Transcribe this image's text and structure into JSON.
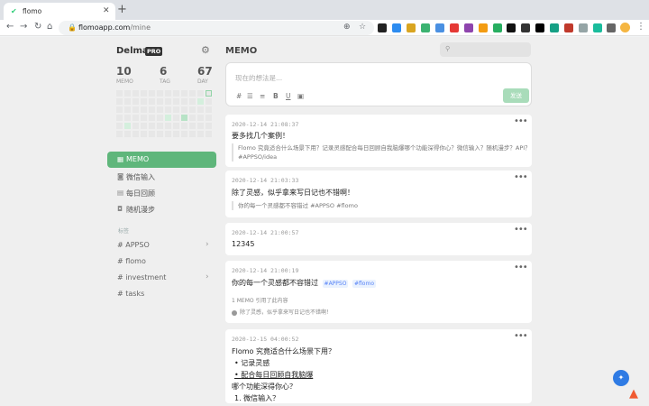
{
  "browser": {
    "tab_title": "flomo",
    "url_host": "flomoapp.com",
    "url_path": "/mine"
  },
  "sidebar": {
    "username": "Delmar",
    "badge": "PRO",
    "stats": [
      {
        "value": "10",
        "label": "MEMO"
      },
      {
        "value": "6",
        "label": "TAG"
      },
      {
        "value": "67",
        "label": "DAY"
      }
    ],
    "nav": [
      {
        "label": "MEMO",
        "icon": "grid-icon",
        "active": true
      },
      {
        "label": "微信输入",
        "icon": "wechat-icon",
        "active": false
      },
      {
        "label": "每日回顾",
        "icon": "calendar-icon",
        "active": false
      },
      {
        "label": "随机漫步",
        "icon": "chat-icon",
        "active": false
      }
    ],
    "tags_heading": "标签",
    "tags": [
      {
        "label": "# APPSO",
        "expandable": true
      },
      {
        "label": "# flomo",
        "expandable": false
      },
      {
        "label": "# investment",
        "expandable": true
      },
      {
        "label": "# tasks",
        "expandable": false
      }
    ]
  },
  "main": {
    "title": "MEMO",
    "editor": {
      "placeholder": "现在的想法是...",
      "tools": [
        "#",
        "☰",
        "≡",
        "B",
        "U",
        "▣"
      ],
      "send_label": "发送"
    },
    "memos": [
      {
        "time": "2020-12-14 21:08:37",
        "text": "要多找几个案例！",
        "quote_lines": [
          "Flomo 究竟适合什么场景下用？记录灵感配合每日回顾自我脑爆哪个功能深得你心？微信输入？随机漫步？API？",
          "#APPSO/idea"
        ]
      },
      {
        "time": "2020-12-14 21:03:33",
        "text": "除了灵感，似乎拿来写日记也不错啊！",
        "quote_lines": [
          "你的每一个灵感都不容错过 #APPSO #flomo"
        ]
      },
      {
        "time": "2020-12-14 21:00:57",
        "text": "12345"
      },
      {
        "time": "2020-12-14 21:00:19",
        "text": "你的每一个灵感都不容错过",
        "tags": [
          "#APPSO",
          "#flomo"
        ],
        "ref_count": "1 MEMO 引用了此内容",
        "ref_text": "除了灵感，似乎拿来写日记也不错啊！"
      },
      {
        "time": "2020-12-15 04:00:52",
        "text": "Flomo 究竟适合什么场景下用？",
        "bullets": [
          "记录灵感",
          "配合每日回顾自我脑爆"
        ],
        "text2": "哪个功能深得你心？",
        "numbered": [
          "1. 微信输入？"
        ]
      }
    ]
  },
  "colors": {
    "brand_green": "#5fb67b",
    "tag_blue": "#5783f7",
    "fab_blue": "#2f7be4"
  }
}
